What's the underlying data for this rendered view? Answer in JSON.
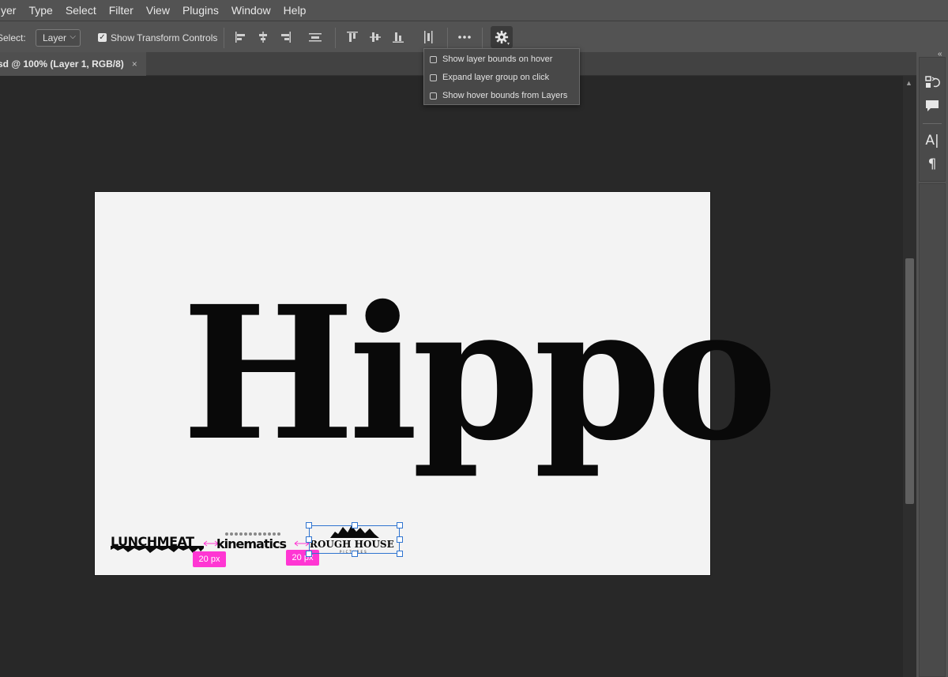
{
  "menu": [
    "yer",
    "Type",
    "Select",
    "Filter",
    "View",
    "Plugins",
    "Window",
    "Help"
  ],
  "options_bar": {
    "select_label": "Select:",
    "select_value": "Layer",
    "show_transform_label": "Show Transform Controls",
    "show_transform_checked": true
  },
  "document_tab": {
    "title": "sd @ 100% (Layer 1, RGB/8)",
    "close_glyph": "×"
  },
  "settings_menu": {
    "options": [
      {
        "label": "Show layer bounds on hover",
        "checked": false
      },
      {
        "label": "Expand layer group on click",
        "checked": false
      },
      {
        "label": "Show hover bounds from Layers",
        "checked": false
      }
    ]
  },
  "canvas": {
    "headline": "Hippo",
    "logos": [
      {
        "text": "LUNCHMEAT"
      },
      {
        "text": "kinematics"
      },
      {
        "text": "ROUGH HOUSE",
        "subtext": "PICTURES"
      }
    ],
    "gap_labels": [
      "20 px",
      "20 px"
    ]
  },
  "colors": {
    "accent_measure": "#ff36d3",
    "selection": "#2f74d0"
  }
}
